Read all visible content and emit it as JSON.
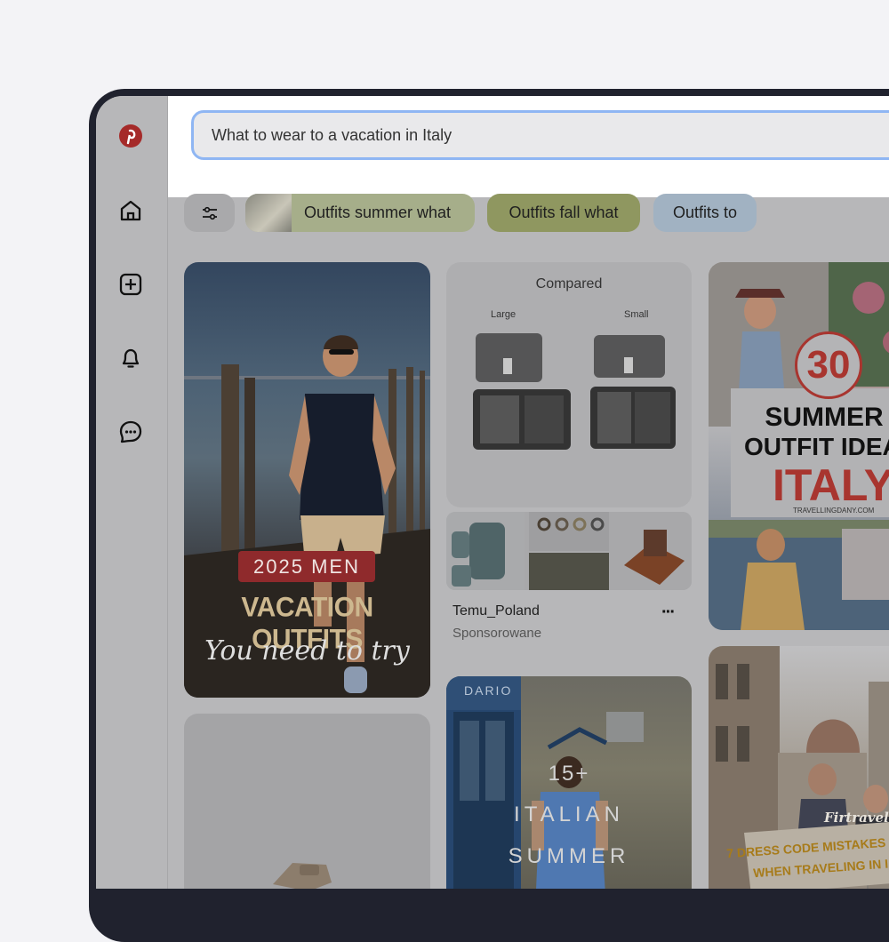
{
  "search": {
    "query": "What to wear to a vacation in Italy"
  },
  "chips": [
    {
      "label": "Outfits summer what",
      "color": "#a6ae8a"
    },
    {
      "label": "Outfits fall what",
      "color": "#8f9760"
    },
    {
      "label": "Outfits to",
      "color": "#a1b2c2"
    }
  ],
  "pins": {
    "men": {
      "badge": "2025 MEN",
      "title": "VACATION OUTFITS",
      "script": "You need to try"
    },
    "compare": {
      "header": "Compared",
      "large": "Large",
      "small": "Small"
    },
    "ad": {
      "name": "Temu_Poland",
      "sponsored": "Sponsorowane",
      "more": "···"
    },
    "italy": {
      "number": "30",
      "line1": "SUMMER",
      "line2": "OUTFIT IDEA",
      "line3": "ITALY",
      "site": "TRAVELLINGDANY.COM"
    },
    "summer": {
      "sign": "DARIO",
      "count": "15+",
      "word1": "ITALIAN",
      "word2": "SUMMER"
    },
    "florence": {
      "script": "Firtravel",
      "banner1": "7 DRESS CODE MISTAKES",
      "banner2": "WHEN TRAVELING IN I"
    }
  },
  "colors": {
    "accent": "#bd2f2c",
    "focus": "#8fb6f3"
  },
  "icons": [
    "pinterest-logo-icon",
    "home-icon",
    "create-icon",
    "notifications-icon",
    "messages-icon",
    "filter-icon",
    "more-options-icon"
  ]
}
